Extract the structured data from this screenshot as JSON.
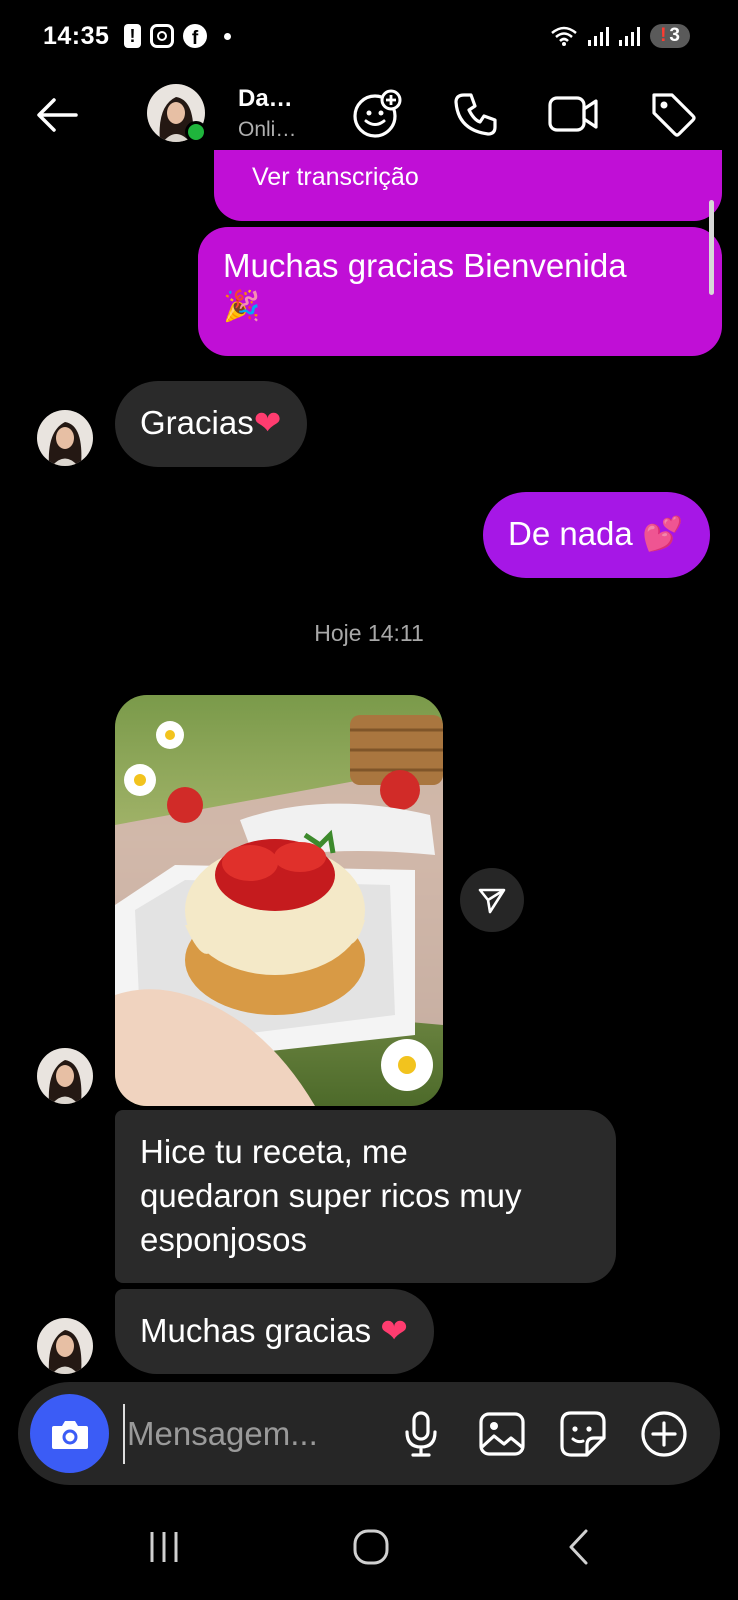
{
  "status_bar": {
    "time": "14:35",
    "alert_glyph": "!",
    "facebook_glyph": "f",
    "notification_count": "3",
    "notification_alert": "!"
  },
  "header": {
    "contact_name": "Da…",
    "contact_status": "Onli…",
    "icons": [
      "back-arrow-icon",
      "add-collaborator-icon",
      "phone-icon",
      "video-camera-icon",
      "tag-icon"
    ],
    "online_color": "#1fb53c"
  },
  "messages": {
    "partial_top": "Ver transcrição",
    "out_1": "Muchas gracias  Bienvenida",
    "out_1_emoji": "🎉",
    "in_1": "Gracias",
    "in_1_emoji": "❤",
    "out_2": "De nada",
    "out_2_emoji": "💕",
    "timestamp": "Hoje 14:11",
    "in_2_line1": "Hice tu receta, me",
    "in_2_line2": "quedaron super ricos muy",
    "in_2_line3": "esponjosos",
    "in_3": "Muchas gracias",
    "in_3_emoji": "❤"
  },
  "composer": {
    "placeholder": "Mensagem...",
    "icons": [
      "camera-icon",
      "microphone-icon",
      "gallery-icon",
      "sticker-icon",
      "plus-icon"
    ]
  },
  "colors": {
    "outgoing_bubble": "#c00fd6",
    "outgoing_bubble_alt": "#a617e6",
    "incoming_bubble": "#2a2a2a",
    "camera_button": "#3b5cf6"
  }
}
